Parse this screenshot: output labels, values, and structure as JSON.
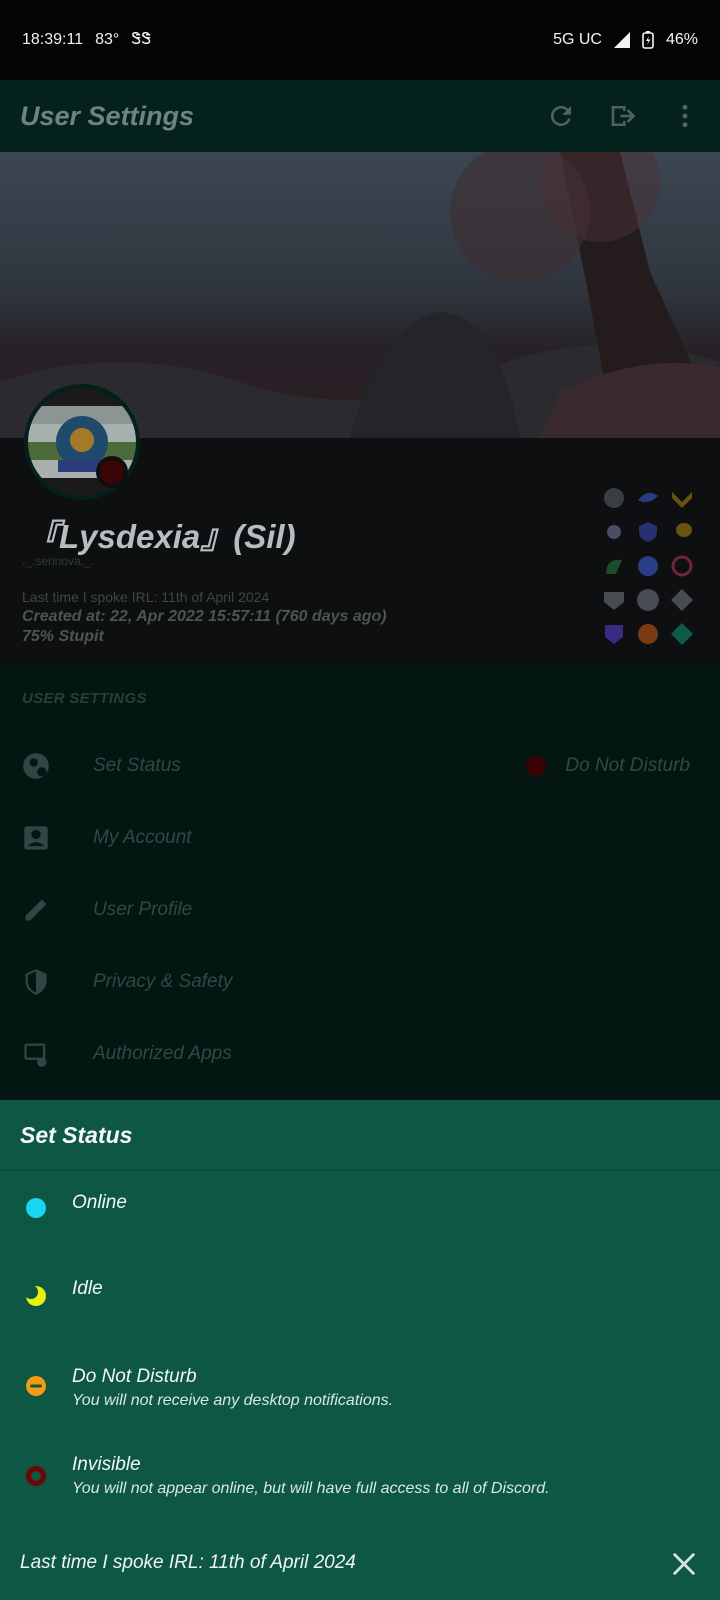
{
  "status_bar": {
    "time": "18:39:11",
    "temp": "83°",
    "extra": "ᏕᏕ",
    "network": "5G UC",
    "battery": "46%"
  },
  "app_bar": {
    "title": "User Settings",
    "icons": [
      "refresh-icon",
      "logout-icon",
      "more-vert-icon"
    ]
  },
  "profile": {
    "display_name": "『Lysdexia』(Sil)",
    "username": "._.serinova._.",
    "bio_line": "Last time I spoke IRL: 11th of April 2024",
    "created": "Created at: 22, Apr 2022 15:57:11 (760 days ago)",
    "tagline": "75% Stupit"
  },
  "settings": {
    "section_title": "USER SETTINGS",
    "items": [
      {
        "label": "Set Status",
        "value": "Do Not Disturb",
        "icon": "status-icon"
      },
      {
        "label": "My Account",
        "value": "",
        "icon": "account-icon"
      },
      {
        "label": "User Profile",
        "value": "",
        "icon": "pencil-icon"
      },
      {
        "label": "Privacy & Safety",
        "value": "",
        "icon": "shield-icon"
      },
      {
        "label": "Authorized Apps",
        "value": "",
        "icon": "apps-icon"
      }
    ]
  },
  "sheet": {
    "title": "Set Status",
    "options": [
      {
        "title": "Online",
        "desc": "",
        "color": "#17d6f2"
      },
      {
        "title": "Idle",
        "desc": "",
        "color": "#e4f20c"
      },
      {
        "title": "Do Not Disturb",
        "desc": "You will not receive any desktop notifications.",
        "color": "#f39c12"
      },
      {
        "title": "Invisible",
        "desc": "You will not appear online, but will have full access to all of Discord.",
        "color": "#6b0707"
      }
    ],
    "custom_status": "Last time I spoke IRL: 11th of April 2024"
  },
  "colors": {
    "sheet_bg": "#0d5744",
    "app_bar_bg": "#05211c"
  }
}
